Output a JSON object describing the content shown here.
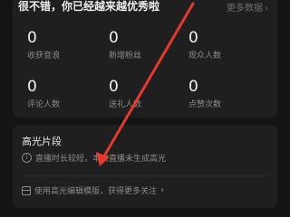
{
  "summary": {
    "headline": "很不错，你已经越来越优秀啦",
    "more_label": "更多数据"
  },
  "stats": [
    {
      "value": "0",
      "label": "收获音浪"
    },
    {
      "value": "0",
      "label": "新增粉丝"
    },
    {
      "value": "0",
      "label": "观众人数"
    },
    {
      "value": "0",
      "label": "评论人数"
    },
    {
      "value": "0",
      "label": "送礼人数"
    },
    {
      "value": "0",
      "label": "点赞次数"
    }
  ],
  "highlights": {
    "title": "高光片段",
    "notice": "直播时长较短，本次直播未生成高光",
    "template_link": "使用高光编辑模版，获得更多关注"
  },
  "icons": {
    "info": "info-icon",
    "template": "template-icon",
    "chevron": "chevron-right-icon"
  },
  "colors": {
    "background": "#141414",
    "card": "#1f1f1f",
    "annotation_arrow": "#e53a2f"
  }
}
